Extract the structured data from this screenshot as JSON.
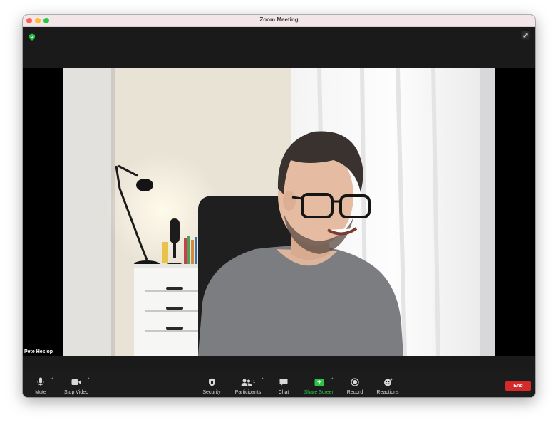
{
  "window": {
    "title": "Zoom Meeting"
  },
  "participant": {
    "name": "Pete Heslop"
  },
  "toolbar": {
    "mute_label": "Mute",
    "stop_video_label": "Stop Video",
    "security_label": "Security",
    "participants_label": "Participants",
    "participants_count": "1",
    "chat_label": "Chat",
    "share_screen_label": "Share Screen",
    "record_label": "Record",
    "reactions_label": "Reactions",
    "end_label": "End"
  },
  "colors": {
    "share_screen": "#2dc44a",
    "end": "#d62a2a",
    "shield": "#23c24a"
  },
  "icons": {
    "mute": "microphone-icon",
    "video": "video-camera-icon",
    "security": "shield-icon",
    "participants": "people-icon",
    "chat": "chat-bubble-icon",
    "share": "share-arrow-icon",
    "record": "record-icon",
    "reactions": "smiley-icon",
    "fullscreen": "expand-icon",
    "encryption": "shield-check-icon"
  }
}
